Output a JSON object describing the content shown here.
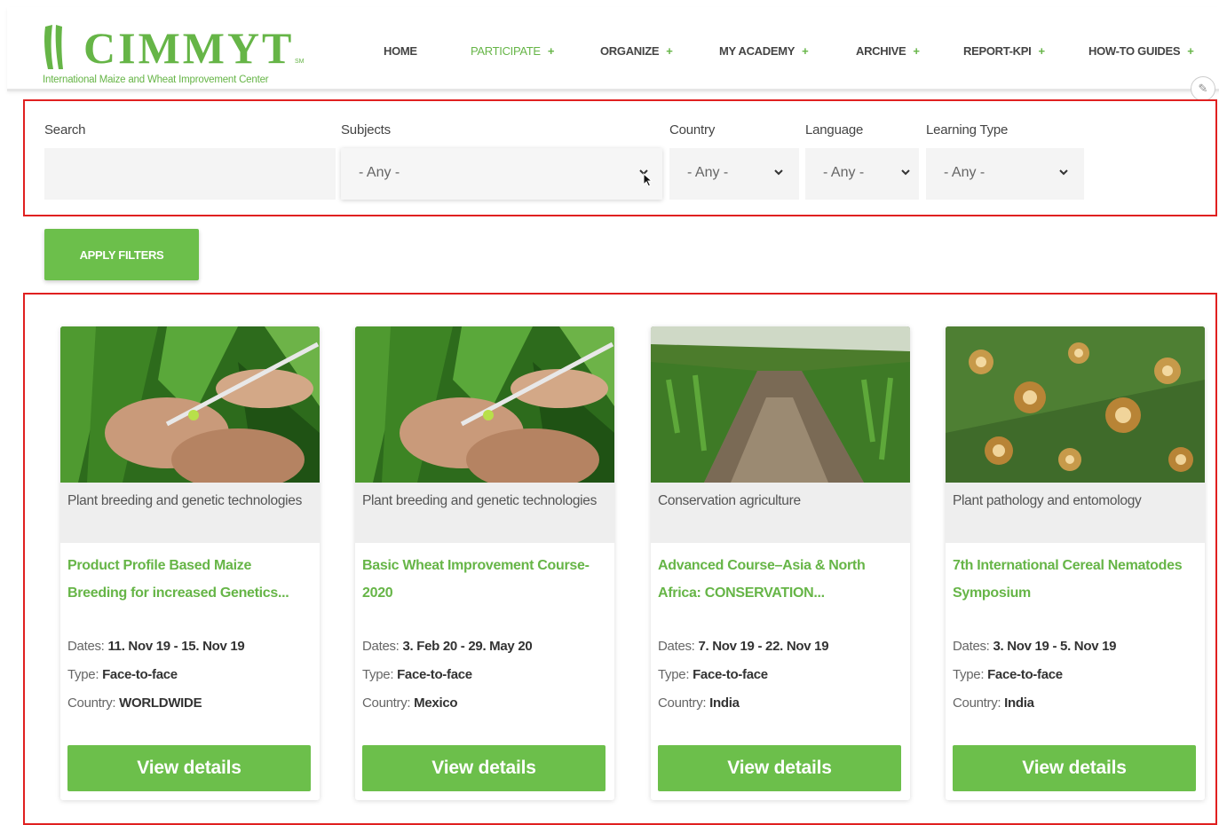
{
  "brand": {
    "name": "CIMMYT",
    "tagline": "International Maize and Wheat Improvement Center",
    "trademark": "SM",
    "color": "#66b547"
  },
  "nav": {
    "items": [
      {
        "label": "HOME",
        "has_submenu": false,
        "active": false
      },
      {
        "label": "PARTICIPATE",
        "has_submenu": true,
        "active": true
      },
      {
        "label": "ORGANIZE",
        "has_submenu": true,
        "active": false
      },
      {
        "label": "MY ACADEMY",
        "has_submenu": true,
        "active": false
      },
      {
        "label": "ARCHIVE",
        "has_submenu": true,
        "active": false
      },
      {
        "label": "REPORT-KPI",
        "has_submenu": true,
        "active": false
      },
      {
        "label": "HOW-TO GUIDES",
        "has_submenu": true,
        "active": false
      }
    ],
    "plus_symbol": "+",
    "edit_icon": "pencil-icon"
  },
  "filters": {
    "search": {
      "label": "Search",
      "value": ""
    },
    "subjects": {
      "label": "Subjects",
      "value": "- Any -"
    },
    "country": {
      "label": "Country",
      "value": "- Any -"
    },
    "language": {
      "label": "Language",
      "value": "- Any -"
    },
    "learning_type": {
      "label": "Learning Type",
      "value": "- Any -"
    },
    "apply_label": "APPLY FILTERS"
  },
  "cards": [
    {
      "subject": "Plant breeding and genetic technologies",
      "title": "Product Profile Based Maize Breeding for increased Genetics...",
      "dates_label": "Dates:",
      "dates": "11. Nov 19 - 15. Nov 19",
      "type_label": "Type:",
      "type": "Face-to-face",
      "country_label": "Country:",
      "country": "WORLDWIDE",
      "button": "View details",
      "image": "maize-pollination-photo"
    },
    {
      "subject": "Plant breeding and genetic technologies",
      "title": "Basic Wheat Improvement Course-2020",
      "dates_label": "Dates:",
      "dates": "3. Feb 20 - 29. May 20",
      "type_label": "Type:",
      "type": "Face-to-face",
      "country_label": "Country:",
      "country": "Mexico",
      "button": "View details",
      "image": "maize-pollination-photo"
    },
    {
      "subject": "Conservation agriculture",
      "title": "Advanced Course–Asia & North Africa: CONSERVATION...",
      "dates_label": "Dates:",
      "dates": "7. Nov 19 - 22. Nov 19",
      "type_label": "Type:",
      "type": "Face-to-face",
      "country_label": "Country:",
      "country": "India",
      "button": "View details",
      "image": "maize-field-photo"
    },
    {
      "subject": "Plant pathology and entomology",
      "title": "7th International Cereal Nematodes Symposium",
      "dates_label": "Dates:",
      "dates": "3. Nov 19 - 5. Nov 19",
      "type_label": "Type:",
      "type": "Face-to-face",
      "country_label": "Country:",
      "country": "India",
      "button": "View details",
      "image": "leaf-disease-photo"
    }
  ],
  "colors": {
    "accent": "#6cbf4b",
    "highlight_border": "#e02020"
  }
}
